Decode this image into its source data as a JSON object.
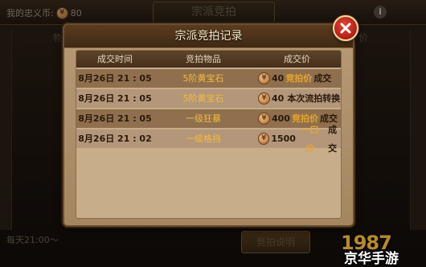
{
  "background": {
    "title": "宗派竞拍",
    "loyalty_label": "我的忠义币:",
    "loyalty_value": "80",
    "info_symbol": "i",
    "column_left": "物",
    "column_right": "价",
    "footer_text": "每天21:00～",
    "bottom_button_label": "竞拍说明"
  },
  "modal": {
    "title": "宗派竞拍记录",
    "close_symbol": "×",
    "columns": [
      "成交时间",
      "竞拍物品",
      "成交价"
    ],
    "rows": [
      {
        "time": "8月26日 21 : 05",
        "item": "5阶黄宝石",
        "price": "40",
        "note_highlight": "竞拍价",
        "note_rest": "成交"
      },
      {
        "time": "8月26日 21 : 05",
        "item": "5阶黄宝石",
        "price": "40",
        "note_highlight": "",
        "note_rest": "本次流拍转换"
      },
      {
        "time": "8月26日 21 : 05",
        "item": "一级狂暴",
        "price": "400",
        "note_highlight": "竞拍价",
        "note_rest": "成交"
      },
      {
        "time": "8月26日 21 : 02",
        "item": "一级格挡",
        "price": "1500",
        "note_highlight": "一口价",
        "note_rest": "成交"
      }
    ]
  },
  "watermark": {
    "logo": "1987",
    "text": "京华手游"
  }
}
